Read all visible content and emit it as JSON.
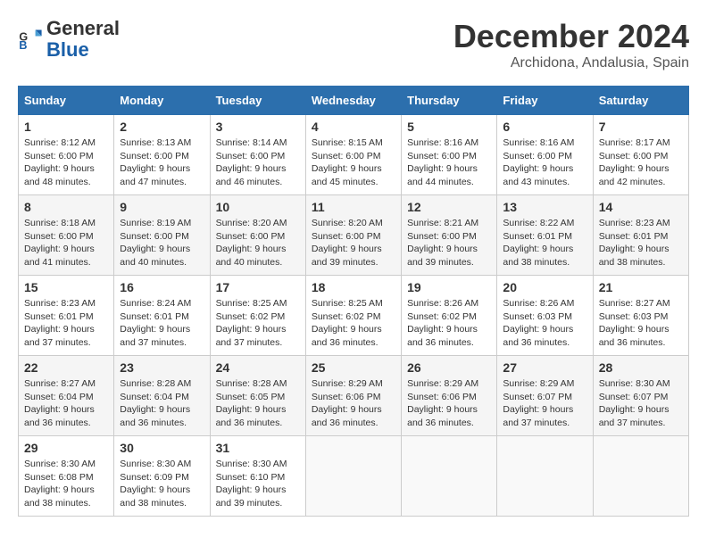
{
  "logo": {
    "line1": "General",
    "line2": "Blue"
  },
  "title": "December 2024",
  "subtitle": "Archidona, Andalusia, Spain",
  "header": {
    "days": [
      "Sunday",
      "Monday",
      "Tuesday",
      "Wednesday",
      "Thursday",
      "Friday",
      "Saturday"
    ]
  },
  "weeks": [
    [
      {
        "day": "1",
        "sunrise": "Sunrise: 8:12 AM",
        "sunset": "Sunset: 6:00 PM",
        "daylight": "Daylight: 9 hours and 48 minutes."
      },
      {
        "day": "2",
        "sunrise": "Sunrise: 8:13 AM",
        "sunset": "Sunset: 6:00 PM",
        "daylight": "Daylight: 9 hours and 47 minutes."
      },
      {
        "day": "3",
        "sunrise": "Sunrise: 8:14 AM",
        "sunset": "Sunset: 6:00 PM",
        "daylight": "Daylight: 9 hours and 46 minutes."
      },
      {
        "day": "4",
        "sunrise": "Sunrise: 8:15 AM",
        "sunset": "Sunset: 6:00 PM",
        "daylight": "Daylight: 9 hours and 45 minutes."
      },
      {
        "day": "5",
        "sunrise": "Sunrise: 8:16 AM",
        "sunset": "Sunset: 6:00 PM",
        "daylight": "Daylight: 9 hours and 44 minutes."
      },
      {
        "day": "6",
        "sunrise": "Sunrise: 8:16 AM",
        "sunset": "Sunset: 6:00 PM",
        "daylight": "Daylight: 9 hours and 43 minutes."
      },
      {
        "day": "7",
        "sunrise": "Sunrise: 8:17 AM",
        "sunset": "Sunset: 6:00 PM",
        "daylight": "Daylight: 9 hours and 42 minutes."
      }
    ],
    [
      {
        "day": "8",
        "sunrise": "Sunrise: 8:18 AM",
        "sunset": "Sunset: 6:00 PM",
        "daylight": "Daylight: 9 hours and 41 minutes."
      },
      {
        "day": "9",
        "sunrise": "Sunrise: 8:19 AM",
        "sunset": "Sunset: 6:00 PM",
        "daylight": "Daylight: 9 hours and 40 minutes."
      },
      {
        "day": "10",
        "sunrise": "Sunrise: 8:20 AM",
        "sunset": "Sunset: 6:00 PM",
        "daylight": "Daylight: 9 hours and 40 minutes."
      },
      {
        "day": "11",
        "sunrise": "Sunrise: 8:20 AM",
        "sunset": "Sunset: 6:00 PM",
        "daylight": "Daylight: 9 hours and 39 minutes."
      },
      {
        "day": "12",
        "sunrise": "Sunrise: 8:21 AM",
        "sunset": "Sunset: 6:00 PM",
        "daylight": "Daylight: 9 hours and 39 minutes."
      },
      {
        "day": "13",
        "sunrise": "Sunrise: 8:22 AM",
        "sunset": "Sunset: 6:01 PM",
        "daylight": "Daylight: 9 hours and 38 minutes."
      },
      {
        "day": "14",
        "sunrise": "Sunrise: 8:23 AM",
        "sunset": "Sunset: 6:01 PM",
        "daylight": "Daylight: 9 hours and 38 minutes."
      }
    ],
    [
      {
        "day": "15",
        "sunrise": "Sunrise: 8:23 AM",
        "sunset": "Sunset: 6:01 PM",
        "daylight": "Daylight: 9 hours and 37 minutes."
      },
      {
        "day": "16",
        "sunrise": "Sunrise: 8:24 AM",
        "sunset": "Sunset: 6:01 PM",
        "daylight": "Daylight: 9 hours and 37 minutes."
      },
      {
        "day": "17",
        "sunrise": "Sunrise: 8:25 AM",
        "sunset": "Sunset: 6:02 PM",
        "daylight": "Daylight: 9 hours and 37 minutes."
      },
      {
        "day": "18",
        "sunrise": "Sunrise: 8:25 AM",
        "sunset": "Sunset: 6:02 PM",
        "daylight": "Daylight: 9 hours and 36 minutes."
      },
      {
        "day": "19",
        "sunrise": "Sunrise: 8:26 AM",
        "sunset": "Sunset: 6:02 PM",
        "daylight": "Daylight: 9 hours and 36 minutes."
      },
      {
        "day": "20",
        "sunrise": "Sunrise: 8:26 AM",
        "sunset": "Sunset: 6:03 PM",
        "daylight": "Daylight: 9 hours and 36 minutes."
      },
      {
        "day": "21",
        "sunrise": "Sunrise: 8:27 AM",
        "sunset": "Sunset: 6:03 PM",
        "daylight": "Daylight: 9 hours and 36 minutes."
      }
    ],
    [
      {
        "day": "22",
        "sunrise": "Sunrise: 8:27 AM",
        "sunset": "Sunset: 6:04 PM",
        "daylight": "Daylight: 9 hours and 36 minutes."
      },
      {
        "day": "23",
        "sunrise": "Sunrise: 8:28 AM",
        "sunset": "Sunset: 6:04 PM",
        "daylight": "Daylight: 9 hours and 36 minutes."
      },
      {
        "day": "24",
        "sunrise": "Sunrise: 8:28 AM",
        "sunset": "Sunset: 6:05 PM",
        "daylight": "Daylight: 9 hours and 36 minutes."
      },
      {
        "day": "25",
        "sunrise": "Sunrise: 8:29 AM",
        "sunset": "Sunset: 6:06 PM",
        "daylight": "Daylight: 9 hours and 36 minutes."
      },
      {
        "day": "26",
        "sunrise": "Sunrise: 8:29 AM",
        "sunset": "Sunset: 6:06 PM",
        "daylight": "Daylight: 9 hours and 36 minutes."
      },
      {
        "day": "27",
        "sunrise": "Sunrise: 8:29 AM",
        "sunset": "Sunset: 6:07 PM",
        "daylight": "Daylight: 9 hours and 37 minutes."
      },
      {
        "day": "28",
        "sunrise": "Sunrise: 8:30 AM",
        "sunset": "Sunset: 6:07 PM",
        "daylight": "Daylight: 9 hours and 37 minutes."
      }
    ],
    [
      {
        "day": "29",
        "sunrise": "Sunrise: 8:30 AM",
        "sunset": "Sunset: 6:08 PM",
        "daylight": "Daylight: 9 hours and 38 minutes."
      },
      {
        "day": "30",
        "sunrise": "Sunrise: 8:30 AM",
        "sunset": "Sunset: 6:09 PM",
        "daylight": "Daylight: 9 hours and 38 minutes."
      },
      {
        "day": "31",
        "sunrise": "Sunrise: 8:30 AM",
        "sunset": "Sunset: 6:10 PM",
        "daylight": "Daylight: 9 hours and 39 minutes."
      },
      null,
      null,
      null,
      null
    ]
  ]
}
